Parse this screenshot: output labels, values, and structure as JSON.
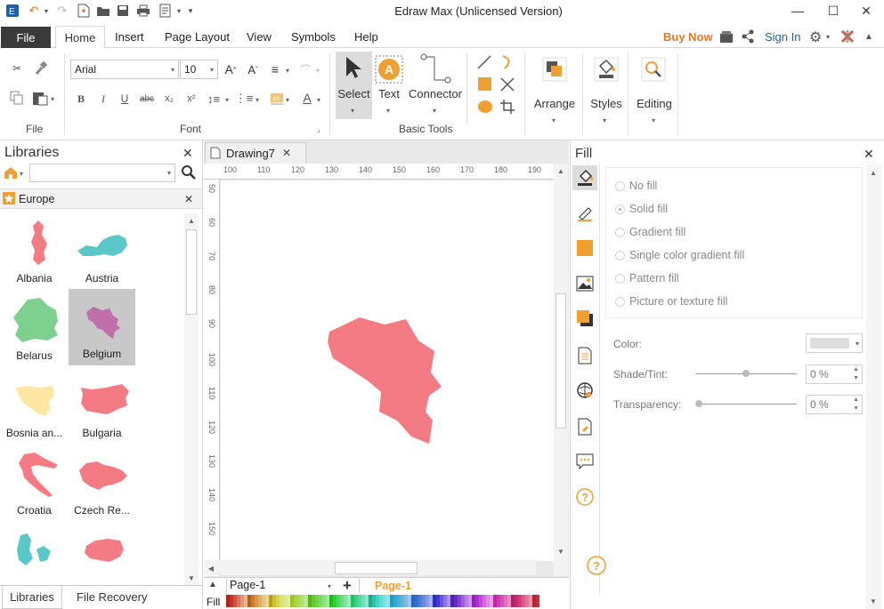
{
  "app": {
    "title": "Edraw Max (Unlicensed Version)"
  },
  "menu": {
    "file": "File",
    "tabs": [
      "Home",
      "Insert",
      "Page Layout",
      "View",
      "Symbols",
      "Help"
    ],
    "buy_now": "Buy Now",
    "sign_in": "Sign In"
  },
  "ribbon": {
    "groups": {
      "file": "File",
      "font": "Font",
      "basic_tools": "Basic Tools"
    },
    "font_name": "Arial",
    "font_size": "10",
    "buttons": {
      "select": "Select",
      "text": "Text",
      "connector": "Connector",
      "arrange": "Arrange",
      "styles": "Styles",
      "editing": "Editing"
    }
  },
  "libraries": {
    "title": "Libraries",
    "category": "Europe",
    "items": [
      {
        "label": "Albania",
        "color": "#f47b83"
      },
      {
        "label": "Austria",
        "color": "#5bc8c8"
      },
      {
        "label": "Belarus",
        "color": "#7dd08e"
      },
      {
        "label": "Belgium",
        "color": "#c06fa8"
      },
      {
        "label": "Bosnia an...",
        "color": "#fde7a3"
      },
      {
        "label": "Bulgaria",
        "color": "#f47b83"
      },
      {
        "label": "Croatia",
        "color": "#f47b83"
      },
      {
        "label": "Czech Re...",
        "color": "#f47b83"
      },
      {
        "label": "",
        "color": "#5bc8c8"
      },
      {
        "label": "",
        "color": "#f47b83"
      }
    ],
    "bottom_tabs": [
      "Libraries",
      "File Recovery"
    ]
  },
  "document": {
    "tab": "Drawing7",
    "ruler_h": [
      "100",
      "110",
      "120",
      "130",
      "140",
      "150",
      "160",
      "170",
      "180",
      "190"
    ],
    "ruler_v": [
      "50",
      "60",
      "70",
      "80",
      "90",
      "100",
      "110",
      "120",
      "130",
      "140",
      "150"
    ],
    "shape_color": "#f47b83"
  },
  "pages": {
    "current": "Page-1",
    "active_tab": "Page-1",
    "fill_label": "Fill"
  },
  "fill_panel": {
    "title": "Fill",
    "options": [
      "No fill",
      "Solid fill",
      "Gradient fill",
      "Single color gradient fill",
      "Pattern fill",
      "Picture or texture fill"
    ],
    "selected": "Solid fill",
    "color_label": "Color:",
    "shade_label": "Shade/Tint:",
    "shade_value": "0 %",
    "transparency_label": "Transparency:",
    "transparency_value": "0 %"
  },
  "colors": {
    "accent": "#f0a030",
    "buy": "#e87722",
    "link": "#1f5fa8"
  }
}
